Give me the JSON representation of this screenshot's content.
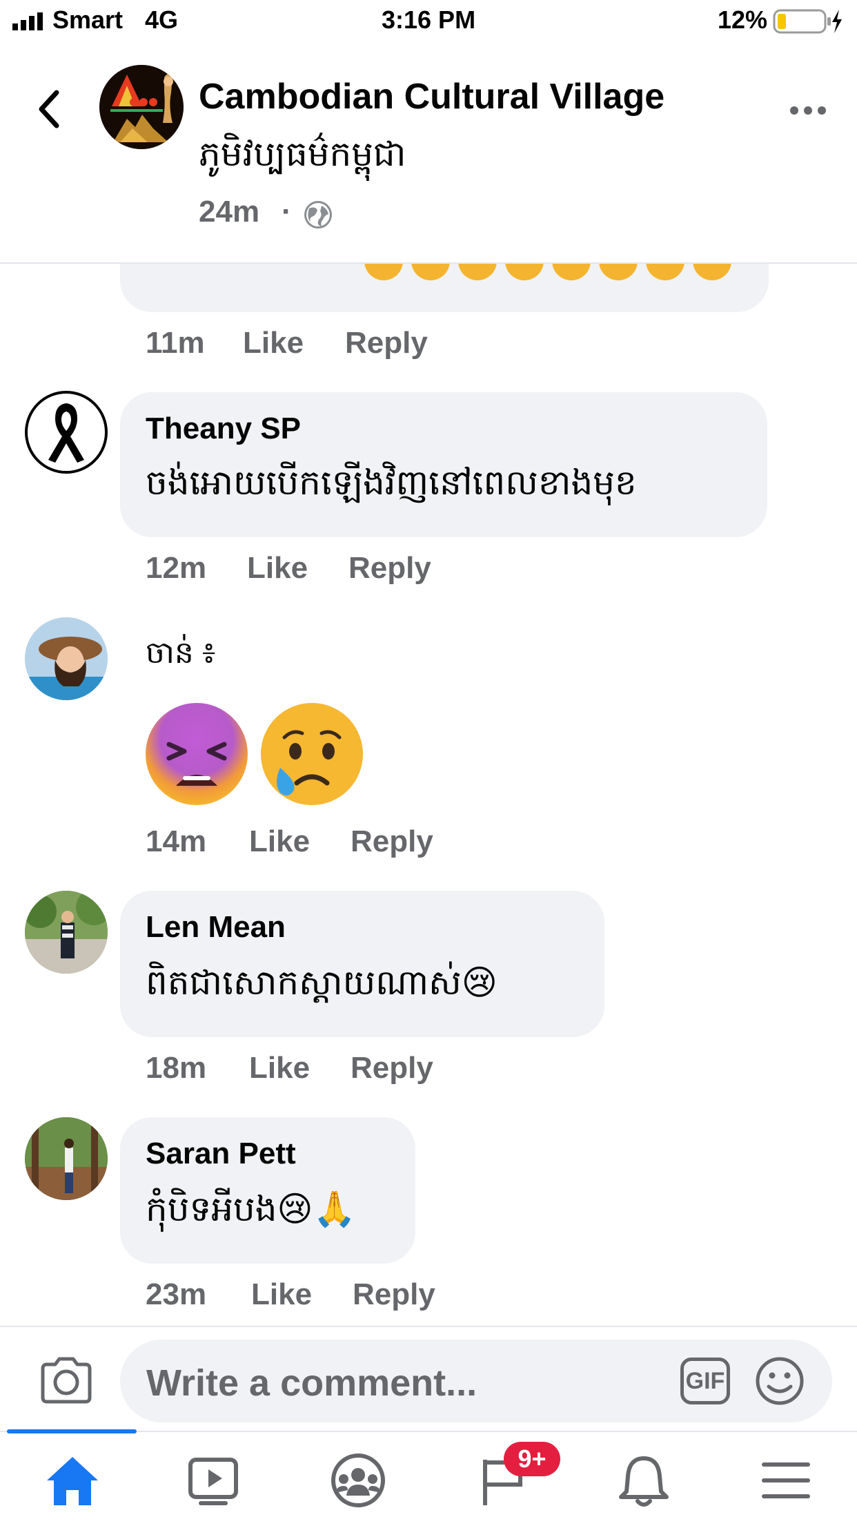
{
  "status_bar": {
    "carrier": "Smart",
    "network": "4G",
    "time": "3:16 PM",
    "battery": "12%"
  },
  "header": {
    "page_name": "Cambodian Cultural Village",
    "page_name_khmer": "ភូមិវប្បធម៌កម្ពុជា",
    "time": "24m",
    "separator": "·",
    "back_icon": "chevron-left-icon",
    "more_icon": "more-horizontal-icon",
    "privacy_icon": "globe-icon"
  },
  "partial_comment": {
    "time": "11m",
    "like": "Like",
    "reply": "Reply"
  },
  "comments": [
    {
      "name": "Theany SP",
      "text": "ចង់អោយបើកឡើងវិញនៅពេលខាងមុខ",
      "time": "12m",
      "like": "Like",
      "reply": "Reply"
    },
    {
      "name": "",
      "text": "ចាន់ ៖",
      "time": "14m",
      "like": "Like",
      "reply": "Reply"
    },
    {
      "name": "Len Mean",
      "text": "ពិតជាសោកស្តាយណាស់😢",
      "time": "18m",
      "like": "Like",
      "reply": "Reply"
    },
    {
      "name": "Saran Pett",
      "text": "កុំបិទអីបង😢🙏",
      "time": "23m",
      "like": "Like",
      "reply": "Reply"
    }
  ],
  "composer": {
    "placeholder": "Write a comment...",
    "gif_label": "GIF"
  },
  "tabbar": {
    "notification_badge": "9+",
    "tabs": [
      "home-icon",
      "watch-icon",
      "groups-icon",
      "pages-icon",
      "notifications-icon",
      "menu-icon"
    ]
  },
  "colors": {
    "accent": "#1877f2",
    "badge": "#e41e3f",
    "secondary_text": "#65676b",
    "bubble": "#f0f2f5",
    "battery": "#f7c600"
  }
}
